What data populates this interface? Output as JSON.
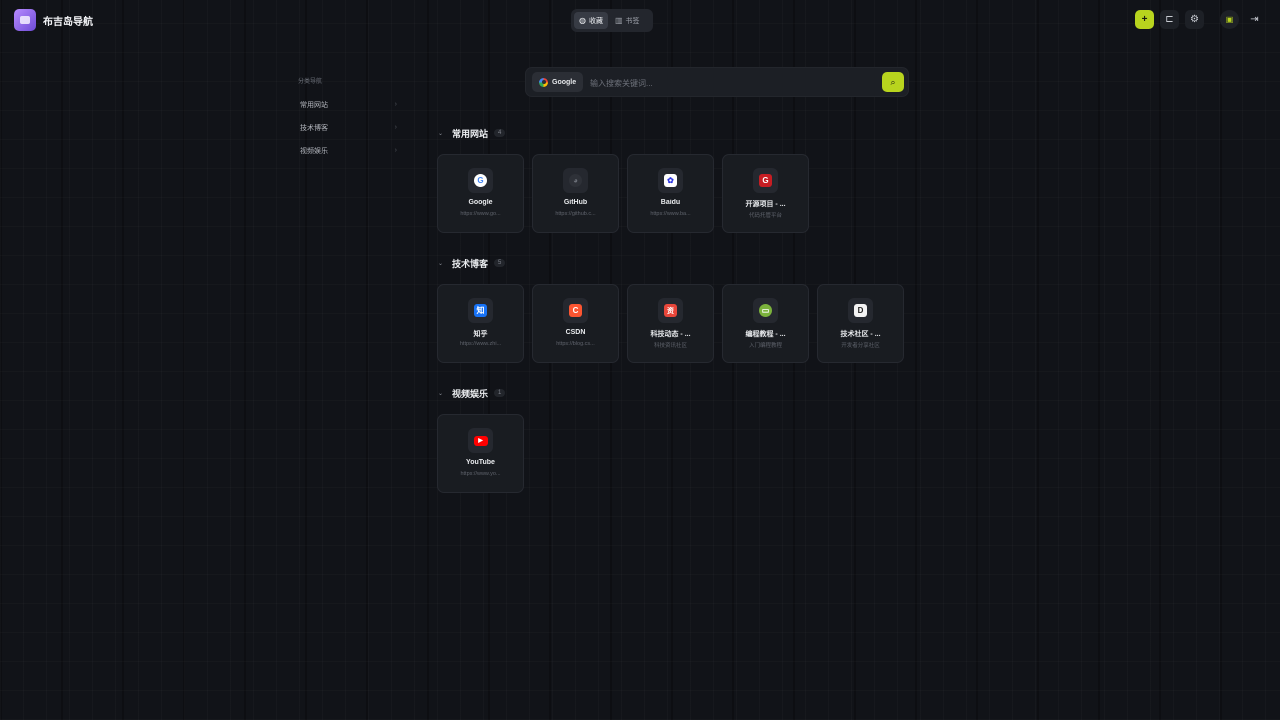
{
  "app": {
    "title": "布吉岛导航"
  },
  "mode_switch": {
    "items": [
      {
        "label": "收藏",
        "active": true
      },
      {
        "label": "书签",
        "active": false
      }
    ]
  },
  "toolbar": {
    "add_label": "+"
  },
  "sidebar": {
    "title": "分类导航",
    "items": [
      {
        "label": "常用网站"
      },
      {
        "label": "技术博客"
      },
      {
        "label": "视频娱乐"
      }
    ]
  },
  "search": {
    "engine": "Google",
    "placeholder": "输入搜索关键词..."
  },
  "colors": {
    "accent": "#b8d41e"
  },
  "sections": [
    {
      "title": "常用网站",
      "count": "4",
      "links": [
        {
          "name": "Google",
          "url": "https://www.go...",
          "icon": "google-icon"
        },
        {
          "name": "GitHub",
          "url": "https://github.c...",
          "icon": "github-icon"
        },
        {
          "name": "Baidu",
          "url": "https://www.ba...",
          "icon": "baidu-icon"
        },
        {
          "name": "开源项目 - ...",
          "url": "代码托管平台",
          "icon": "gitee-icon"
        }
      ]
    },
    {
      "title": "技术博客",
      "count": "5",
      "links": [
        {
          "name": "知乎",
          "url": "https://www.zhi...",
          "icon": "zhihu-icon"
        },
        {
          "name": "CSDN",
          "url": "https://blog.cs...",
          "icon": "csdn-icon"
        },
        {
          "name": "科技动态 - ...",
          "url": "科技资讯社区",
          "icon": "news-icon"
        },
        {
          "name": "编程教程 - ...",
          "url": "入门编程教程",
          "icon": "tutorial-icon"
        },
        {
          "name": "技术社区 - ...",
          "url": "开发者分享社区",
          "icon": "community-icon"
        }
      ]
    },
    {
      "title": "视频娱乐",
      "count": "1",
      "links": [
        {
          "name": "YouTube",
          "url": "https://www.yo...",
          "icon": "youtube-icon"
        }
      ]
    }
  ]
}
